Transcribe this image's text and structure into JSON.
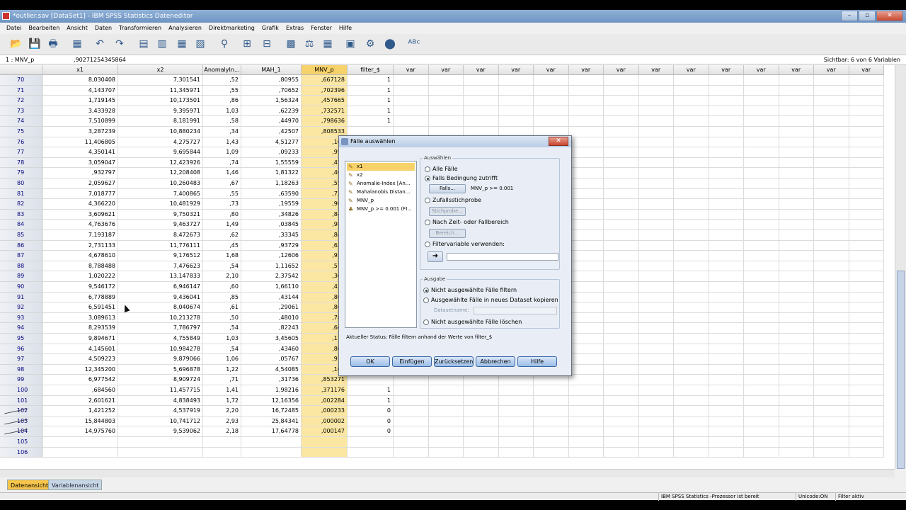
{
  "window": {
    "title": "*outlier.sav [DataSet1] - IBM SPSS Statistics Dateneditor",
    "buttons": [
      "–",
      "▫",
      "✕"
    ]
  },
  "menu": [
    "Datei",
    "Bearbeiten",
    "Ansicht",
    "Daten",
    "Transformieren",
    "Analysieren",
    "Direktmarketing",
    "Grafik",
    "Extras",
    "Fenster",
    "Hilfe"
  ],
  "toolbar_icons": [
    "open-folder-icon",
    "save-icon",
    "print-icon",
    "dialog-recall-icon",
    "undo-icon",
    "redo-icon",
    "goto-case-icon",
    "goto-variable-icon",
    "variables-icon",
    "run-descriptives-icon",
    "find-icon",
    "insert-cases-icon",
    "insert-variable-icon",
    "split-file-icon",
    "weight-cases-icon",
    "select-cases-icon",
    "value-labels-icon",
    "use-sets-icon",
    "show-all-icon",
    "spellcheck-icon"
  ],
  "cellbar": {
    "ref": "1 : MNV_p",
    "value": ",90271254345864",
    "visible": "Sichtbar: 6 von 6 Variablen"
  },
  "columns": [
    "x1",
    "x2",
    "AnomalyIn...",
    "MAH_1",
    "MNV_p",
    "filter_$",
    "var",
    "var",
    "var",
    "var",
    "var",
    "var",
    "var",
    "var",
    "var",
    "var",
    "var",
    "var",
    "var",
    "var"
  ],
  "rows": [
    {
      "n": "70",
      "x1": "8,030408",
      "x2": "7,301541",
      "an": ",52",
      "mah": ",80955",
      "mnv": ",667128",
      "f": "1"
    },
    {
      "n": "71",
      "x1": "4,143707",
      "x2": "11,345971",
      "an": ",55",
      "mah": ",70652",
      "mnv": ",702396",
      "f": "1"
    },
    {
      "n": "72",
      "x1": "1,719145",
      "x2": "10,173501",
      "an": ",86",
      "mah": "1,56324",
      "mnv": ",457665",
      "f": "1"
    },
    {
      "n": "73",
      "x1": "3,433928",
      "x2": "9,395971",
      "an": "1,03",
      "mah": ",62239",
      "mnv": ",732571",
      "f": "1"
    },
    {
      "n": "74",
      "x1": "7,510899",
      "x2": "8,181991",
      "an": ",58",
      "mah": ",44970",
      "mnv": ",798636",
      "f": "1"
    },
    {
      "n": "75",
      "x1": "3,287239",
      "x2": "10,880234",
      "an": ",34",
      "mah": ",42507",
      "mnv": ",808533",
      "f": ""
    },
    {
      "n": "76",
      "x1": "11,406805",
      "x2": "4,275727",
      "an": "1,43",
      "mah": "4,51277",
      "mnv": ",104",
      "f": ""
    },
    {
      "n": "77",
      "x1": "4,350141",
      "x2": "9,695844",
      "an": "1,09",
      "mah": ",09233",
      "mnv": ",954",
      "f": ""
    },
    {
      "n": "78",
      "x1": "3,059047",
      "x2": "12,423926",
      "an": ",74",
      "mah": "1,55559",
      "mnv": ",459",
      "f": ""
    },
    {
      "n": "79",
      "x1": ",932797",
      "x2": "12,208408",
      "an": "1,46",
      "mah": "1,81322",
      "mnv": ",403",
      "f": ""
    },
    {
      "n": "80",
      "x1": "2,059627",
      "x2": "10,260483",
      "an": ",67",
      "mah": "1,18263",
      "mnv": ",553",
      "f": ""
    },
    {
      "n": "81",
      "x1": "7,018777",
      "x2": "7,400865",
      "an": ",55",
      "mah": ",63590",
      "mnv": ",727",
      "f": ""
    },
    {
      "n": "82",
      "x1": "4,366220",
      "x2": "10,481929",
      "an": ",73",
      "mah": ",19559",
      "mnv": ",906",
      "f": ""
    },
    {
      "n": "83",
      "x1": "3,609621",
      "x2": "9,750321",
      "an": ",80",
      "mah": ",34826",
      "mnv": ",840",
      "f": ""
    },
    {
      "n": "84",
      "x1": "4,763676",
      "x2": "9,463727",
      "an": "1,49",
      "mah": ",03845",
      "mnv": ",980",
      "f": ""
    },
    {
      "n": "85",
      "x1": "7,193187",
      "x2": "8,472673",
      "an": ",62",
      "mah": ",33345",
      "mnv": ",846",
      "f": ""
    },
    {
      "n": "86",
      "x1": "2,731133",
      "x2": "11,776111",
      "an": ",45",
      "mah": ",93729",
      "mnv": ",625",
      "f": ""
    },
    {
      "n": "87",
      "x1": "4,678610",
      "x2": "9,176512",
      "an": "1,68",
      "mah": ",12606",
      "mnv": ",938",
      "f": ""
    },
    {
      "n": "88",
      "x1": "8,788488",
      "x2": "7,476623",
      "an": ",54",
      "mah": "1,11652",
      "mnv": ",572",
      "f": ""
    },
    {
      "n": "89",
      "x1": "1,020222",
      "x2": "13,147833",
      "an": "2,10",
      "mah": "2,37542",
      "mnv": ",304",
      "f": ""
    },
    {
      "n": "90",
      "x1": "9,546172",
      "x2": "6,946147",
      "an": ",60",
      "mah": "1,66110",
      "mnv": ",435",
      "f": ""
    },
    {
      "n": "91",
      "x1": "6,778889",
      "x2": "9,436041",
      "an": ",85",
      "mah": ",43144",
      "mnv": ",805",
      "f": ""
    },
    {
      "n": "92",
      "x1": "6,591451",
      "x2": "8,040674",
      "an": ",61",
      "mah": ",29061",
      "mnv": ",864",
      "f": ""
    },
    {
      "n": "93",
      "x1": "3,089613",
      "x2": "10,213278",
      "an": ",50",
      "mah": ",48010",
      "mnv": ",786",
      "f": ""
    },
    {
      "n": "94",
      "x1": "8,293539",
      "x2": "7,786797",
      "an": ",54",
      "mah": ",82243",
      "mnv": ",662",
      "f": ""
    },
    {
      "n": "95",
      "x1": "9,894671",
      "x2": "4,755849",
      "an": "1,03",
      "mah": "3,45605",
      "mnv": ",177",
      "f": ""
    },
    {
      "n": "96",
      "x1": "4,145601",
      "x2": "10,984278",
      "an": ",54",
      "mah": ",43460",
      "mnv": ",804",
      "f": ""
    },
    {
      "n": "97",
      "x1": "4,509223",
      "x2": "9,879066",
      "an": "1,06",
      "mah": ",05767",
      "mnv": ",971",
      "f": ""
    },
    {
      "n": "98",
      "x1": "12,345200",
      "x2": "5,696878",
      "an": "1,22",
      "mah": "4,54085",
      "mnv": ",103",
      "f": ""
    },
    {
      "n": "99",
      "x1": "6,977542",
      "x2": "8,909724",
      "an": ",71",
      "mah": ",31736",
      "mnv": ",853271",
      "f": ""
    },
    {
      "n": "100",
      "x1": ",684560",
      "x2": "11,457715",
      "an": "1,41",
      "mah": "1,98216",
      "mnv": ",371176",
      "f": "1"
    },
    {
      "n": "101",
      "x1": "2,601621",
      "x2": "4,838493",
      "an": "1,72",
      "mah": "12,16356",
      "mnv": ",002284",
      "f": "1"
    },
    {
      "n": "102",
      "x1": "1,421252",
      "x2": "4,537919",
      "an": "2,20",
      "mah": "16,72485",
      "mnv": ",000233",
      "f": "0",
      "struck": true
    },
    {
      "n": "103",
      "x1": "15,844803",
      "x2": "10,741712",
      "an": "2,93",
      "mah": "25,84341",
      "mnv": ",000002",
      "f": "0",
      "struck": true
    },
    {
      "n": "104",
      "x1": "14,975760",
      "x2": "9,539062",
      "an": "2,18",
      "mah": "17,64778",
      "mnv": ",000147",
      "f": "0",
      "struck": true
    },
    {
      "n": "105",
      "x1": "",
      "x2": "",
      "an": "",
      "mah": "",
      "mnv": "",
      "f": ""
    },
    {
      "n": "106",
      "x1": "",
      "x2": "",
      "an": "",
      "mah": "",
      "mnv": "",
      "f": ""
    }
  ],
  "tabs": {
    "data_view": "Datenansicht",
    "variable_view": "Variablenansicht"
  },
  "status": {
    "processor": "IBM SPSS Statistics -Prozessor ist bereit",
    "unicode": "Unicode:ON",
    "filter": "Filter aktiv"
  },
  "dialog": {
    "title": "Fälle auswählen",
    "variables": [
      "x1",
      "x2",
      "Anomalie-Index [An...",
      "Mahalanobis Distan...",
      "MNV_p",
      "MNV_p >= 0.001 (FI..."
    ],
    "select_group": "Auswählen",
    "opt_all": "Alle Fälle",
    "opt_if": "Falls Bedingung zutrifft",
    "btn_if": "Falls...",
    "if_condition": "MNV_p >= 0.001",
    "opt_random": "Zufallsstichprobe",
    "btn_sample": "Stichprobe...",
    "opt_range": "Nach Zeit- oder Fallbereich",
    "btn_range": "Bereich...",
    "opt_filter": "Filtervariable verwenden:",
    "output_group": "Ausgabe",
    "out_filter": "Nicht ausgewählte Fälle filtern",
    "out_copy": "Ausgewählte Fälle in neues Dataset kopieren",
    "dataset_label": "Datasetname:",
    "out_delete": "Nicht ausgewählte Fälle löschen",
    "status": "Aktueller Status: Fälle filtern anhand der Werte von filter_$",
    "buttons": {
      "ok": "OK",
      "paste": "Einfügen",
      "reset": "Zurücksetzen",
      "cancel": "Abbrechen",
      "help": "Hilfe"
    }
  }
}
